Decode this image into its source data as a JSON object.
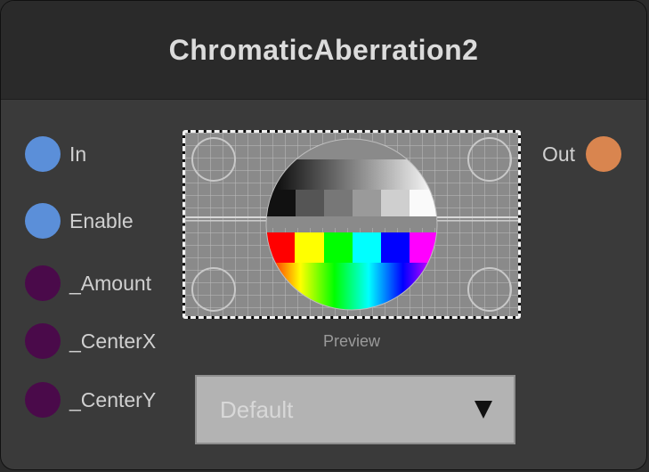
{
  "node": {
    "title": "ChromaticAberration2"
  },
  "inputs": [
    {
      "label": "In",
      "color": "#5b8fd9"
    },
    {
      "label": "Enable",
      "color": "#5b8fd9"
    },
    {
      "label": "_Amount",
      "color": "#4a0a4a"
    },
    {
      "label": "_CenterX",
      "color": "#4a0a4a"
    },
    {
      "label": "_CenterY",
      "color": "#4a0a4a"
    }
  ],
  "outputs": [
    {
      "label": "Out",
      "color": "#d9854f"
    }
  ],
  "preview": {
    "caption": "Preview",
    "test_pattern_colors": [
      "#ff0000",
      "#ffff00",
      "#00ff00",
      "#00ffff",
      "#0000ff",
      "#ff00ff"
    ]
  },
  "dropdown": {
    "selected": "Default",
    "icon": "triangle-down-icon"
  }
}
